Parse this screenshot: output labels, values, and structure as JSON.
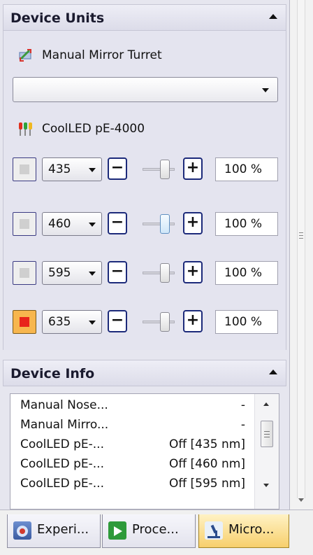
{
  "device_units": {
    "title": "Device Units",
    "turret_name": "Manual Mirror Turret",
    "turret_value": "",
    "led_source_name": "CoolLED pE-4000",
    "channels": [
      {
        "wavelength": "435",
        "intensity": "100 %",
        "enabled": false,
        "level": 0.55
      },
      {
        "wavelength": "460",
        "intensity": "100 %",
        "enabled": false,
        "level": 0.55
      },
      {
        "wavelength": "595",
        "intensity": "100 %",
        "enabled": false,
        "level": 0.55
      },
      {
        "wavelength": "635",
        "intensity": "100 %",
        "enabled": true,
        "level": 0.55
      }
    ],
    "minus_label": "−",
    "plus_label": "+"
  },
  "device_info": {
    "title": "Device Info",
    "rows": [
      {
        "name": "Manual Nose...",
        "value": "-"
      },
      {
        "name": "Manual Mirro...",
        "value": "-"
      },
      {
        "name": "CoolLED pE-...",
        "value": "Off [435 nm]"
      },
      {
        "name": "CoolLED pE-...",
        "value": "Off [460 nm]"
      },
      {
        "name": "CoolLED pE-...",
        "value": "Off [595 nm]"
      }
    ]
  },
  "tabs": [
    {
      "label": "Experi..."
    },
    {
      "label": "Proce..."
    },
    {
      "label": "Micro..."
    }
  ],
  "colors": {
    "active_tab": "#f7cf6c",
    "led_on": "#e8241b",
    "header_text": "#1a1a2e"
  }
}
